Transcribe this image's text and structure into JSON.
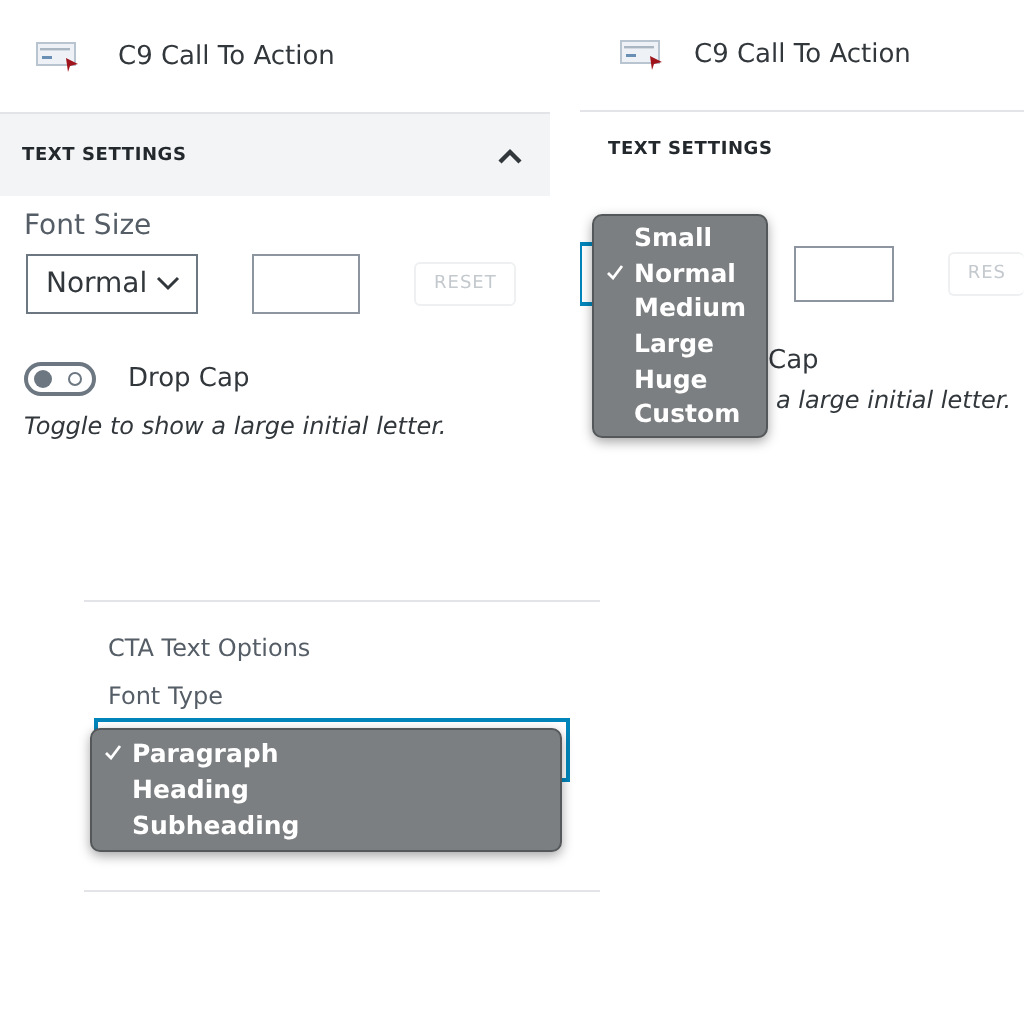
{
  "left_panel": {
    "header": {
      "title": "C9 Call To Action"
    },
    "section": {
      "title": "TEXT SETTINGS",
      "expanded": true
    },
    "font_size": {
      "label": "Font Size",
      "value": "Normal",
      "reset": "RESET"
    },
    "drop_cap": {
      "label": "Drop Cap",
      "on": false,
      "help": "Toggle to show a large initial letter."
    }
  },
  "right_panel": {
    "header": {
      "title": "C9 Call To Action"
    },
    "section": {
      "title": "TEXT SETTINGS"
    },
    "font_size": {
      "reset": "RES"
    },
    "drop_cap": {
      "label": "Cap",
      "help": "a large initial letter."
    },
    "menu": [
      {
        "label": "Small",
        "selected": false
      },
      {
        "label": "Normal",
        "selected": true
      },
      {
        "label": "Medium",
        "selected": false
      },
      {
        "label": "Large",
        "selected": false
      },
      {
        "label": "Huge",
        "selected": false
      },
      {
        "label": "Custom",
        "selected": false
      }
    ]
  },
  "cta_panel": {
    "title": "CTA Text Options",
    "font_type": {
      "label": "Font Type"
    },
    "menu": [
      {
        "label": "Paragraph",
        "selected": true
      },
      {
        "label": "Heading",
        "selected": false
      },
      {
        "label": "Subheading",
        "selected": false
      }
    ]
  }
}
